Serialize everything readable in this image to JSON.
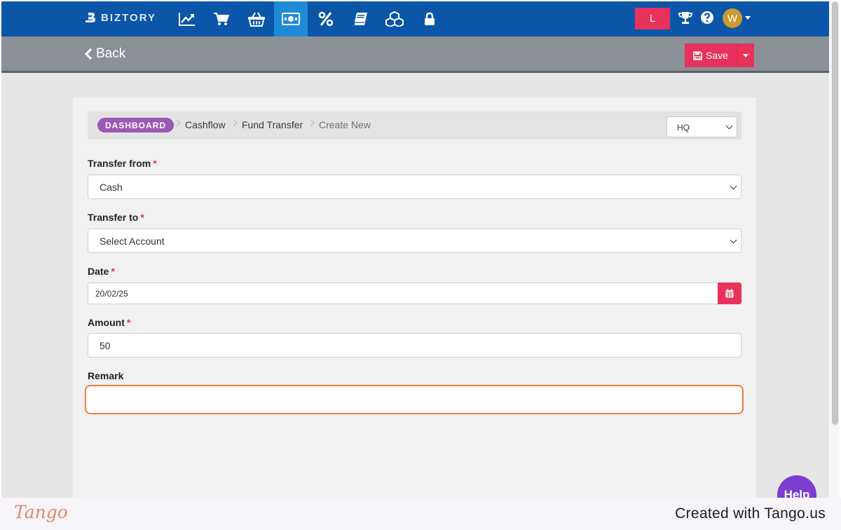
{
  "brand": {
    "name": "BIZTORY"
  },
  "topnav": {
    "icons": [
      "chart-line-icon",
      "cart-icon",
      "basket-icon",
      "money-icon",
      "percent-icon",
      "book-icon",
      "cubes-icon",
      "lock-icon"
    ],
    "active_icon": "money-icon",
    "location_badge": "L",
    "right_icons": [
      "trophy-icon",
      "question-icon"
    ],
    "user_initial": "W"
  },
  "actionbar": {
    "back_label": "Back",
    "save_label": "Save"
  },
  "breadcrumb": {
    "badge": "DASHBOARD",
    "items": [
      "Cashflow",
      "Fund Transfer",
      "Create New"
    ],
    "branch_value": "HQ"
  },
  "form": {
    "transfer_from": {
      "label": "Transfer from",
      "required": "*",
      "value": "Cash"
    },
    "transfer_to": {
      "label": "Transfer to",
      "required": "*",
      "value": "Select Account"
    },
    "date": {
      "label": "Date",
      "required": "*",
      "value": "20/02/25"
    },
    "amount": {
      "label": "Amount",
      "required": "*",
      "value": "50"
    },
    "remark": {
      "label": "Remark",
      "value": ""
    }
  },
  "help_label": "Help",
  "footer": {
    "logo": "Tango",
    "credit": "Created with Tango.us"
  },
  "colors": {
    "nav": "#0b56a8",
    "accent": "#e8315b",
    "badge": "#9b59b6",
    "focus": "#f07a3c"
  }
}
